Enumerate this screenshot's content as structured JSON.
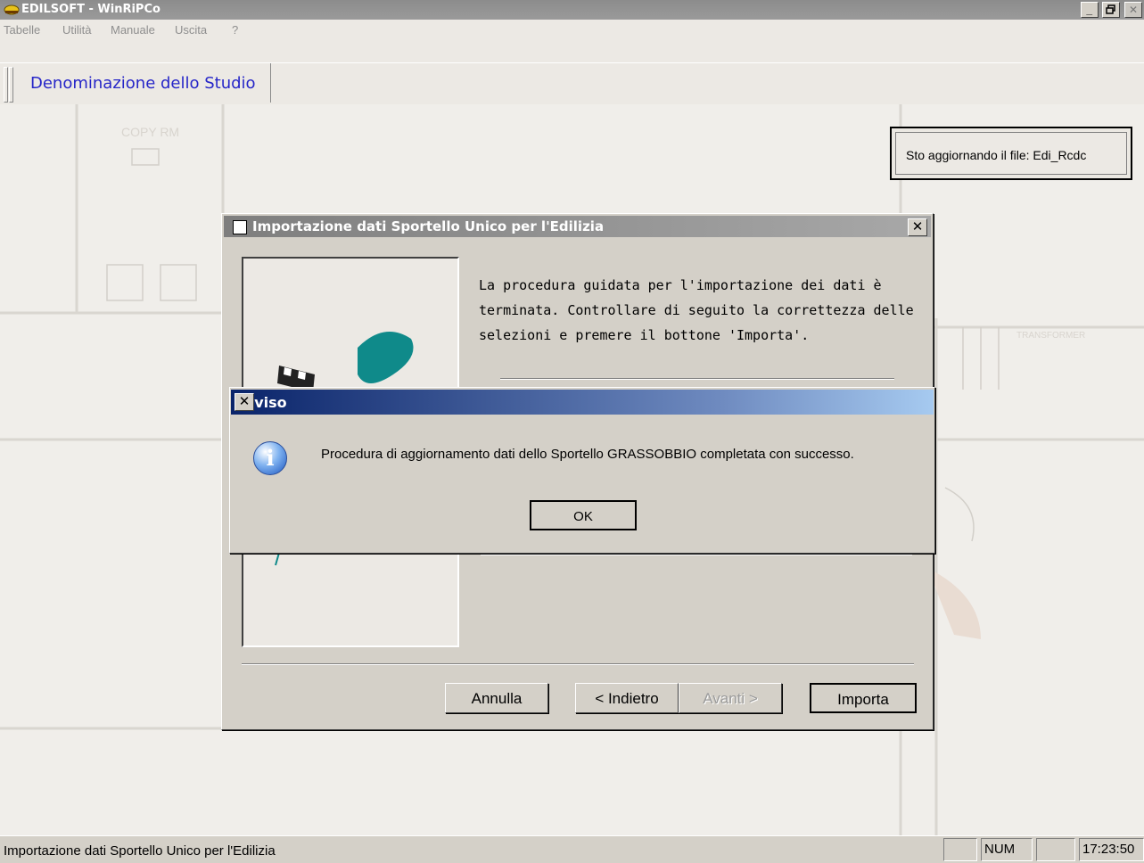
{
  "window": {
    "title": "EDILSOFT - WinRiPCo",
    "minimize": "_",
    "restore": "ё",
    "close": "✕"
  },
  "menu": [
    "Tabelle",
    "Utilità",
    "Manuale",
    "Uscita",
    "?"
  ],
  "toolbar": {
    "studio_label": "Denominazione dello Studio"
  },
  "status_box": {
    "text": "Sto aggiornando il file: Edi_Rcdc"
  },
  "wizard": {
    "title": "Importazione dati Sportello Unico per l'Edilizia",
    "message": "La procedura guidata per l'importazione dei dati è terminata. Controllare di seguito la correttezza delle selezioni e premere il bottone 'Importa'.",
    "buttons": {
      "cancel": "Annulla",
      "back": "< Indietro",
      "next": "Avanti >",
      "import": "Importa"
    }
  },
  "alert": {
    "title": "Avviso",
    "message": "Procedura di aggiornamento dati dello Sportello GRASSOBBIO completata con successo.",
    "ok": "OK",
    "icon": "information-icon"
  },
  "statusbar": {
    "text": "Importazione dati Sportello Unico per l'Edilizia",
    "num": "NUM",
    "time": "17:23:50"
  },
  "colors": {
    "alert_titlebar": "#0a246a",
    "studio_text": "#2626c8",
    "wizard_titlebar_inactive": "#7e7e7e"
  }
}
